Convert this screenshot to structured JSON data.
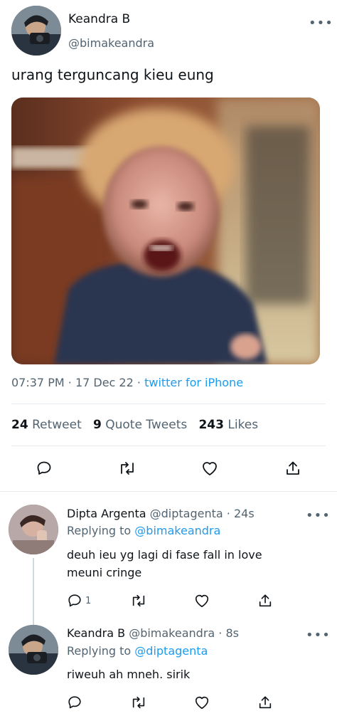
{
  "tweet": {
    "author_name": "Keandra B",
    "author_handle": "@bimakeandra",
    "more_icon": "more-horizontal-icon",
    "more_label": "•••",
    "text": "urang terguncang kieu eung",
    "time": "07:37 PM",
    "date": "17 Dec 22",
    "source": "twitter for iPhone",
    "separator": "·",
    "stats": {
      "retweets_count": "24",
      "retweets_label": "Retweet",
      "quotes_count": "9",
      "quotes_label": "Quote Tweets",
      "likes_count": "243",
      "likes_label": "Likes"
    },
    "actions": [
      "reply-icon",
      "retweet-icon",
      "like-icon",
      "share-icon"
    ]
  },
  "replies": [
    {
      "author_name": "Dipta Argenta",
      "author_handle": "@diptagenta",
      "age": "24s",
      "replying_label": "Replying to",
      "replying_to": "@bimakeandra",
      "text_line1": "deuh ieu yg lagi di fase fall in love",
      "text_line2": "meuni cringe",
      "reply_count": "1",
      "more_label": "•••"
    },
    {
      "author_name": "Keandra B",
      "author_handle": "@bimakeandra",
      "age": "8s",
      "replying_label": "Replying to",
      "replying_to": "@diptagenta",
      "text_line1": "riweuh ah mneh. sirik",
      "more_label": "•••"
    }
  ],
  "colors": {
    "link": "#1d9bf0",
    "secondary_text": "#536471",
    "primary_text": "#0f1419",
    "divider": "#e6ecf0"
  }
}
